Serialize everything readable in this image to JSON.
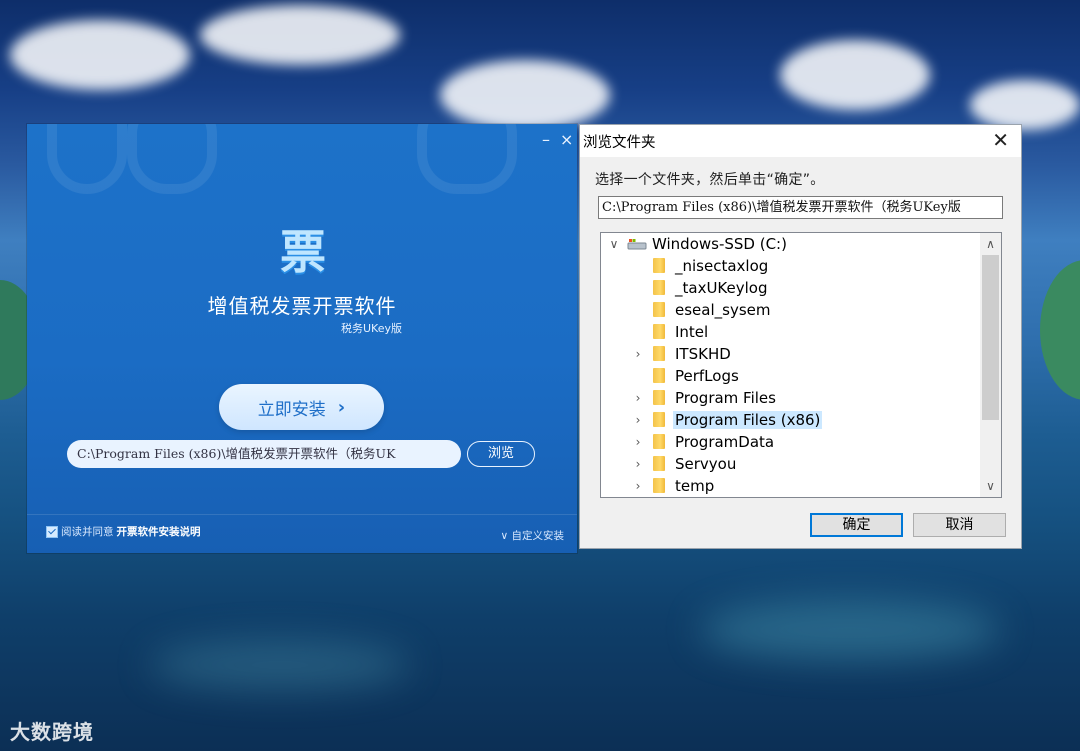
{
  "installer": {
    "minimize_glyph": "–",
    "close_glyph": "×",
    "logo_char": "票",
    "title": "增值税发票开票软件",
    "subtitle": "税务UKey版",
    "install_label": "立即安装",
    "install_chevron": "›",
    "install_path": "C:\\Program Files (x86)\\增值税发票开票软件（税务UK",
    "browse_label": "浏览",
    "agree_prefix": "阅读并同意",
    "agree_link": "开票软件安装说明",
    "agree_checked": true,
    "custom_install": "∨ 自定义安装"
  },
  "dialog": {
    "title": "浏览文件夹",
    "close_glyph": "✕",
    "instruction": "选择一个文件夹，然后单击“确定”。",
    "path_value": "C:\\Program Files (x86)\\增值税发票开票软件（税务UKey版",
    "tree": {
      "root_expander": "∨",
      "root_label": "Windows-SSD (C:)",
      "items": [
        {
          "label": "_nisectaxlog",
          "expander": ""
        },
        {
          "label": "_taxUKeylog",
          "expander": ""
        },
        {
          "label": "eseal_sysem",
          "expander": ""
        },
        {
          "label": "Intel",
          "expander": ""
        },
        {
          "label": "ITSKHD",
          "expander": "›"
        },
        {
          "label": "PerfLogs",
          "expander": ""
        },
        {
          "label": "Program Files",
          "expander": "›"
        },
        {
          "label": "Program Files (x86)",
          "expander": "›",
          "selected": true
        },
        {
          "label": "ProgramData",
          "expander": "›"
        },
        {
          "label": "Servyou",
          "expander": "›"
        },
        {
          "label": "temp",
          "expander": "›"
        }
      ]
    },
    "scroll_up": "∧",
    "scroll_down": "∨",
    "ok_label": "确定",
    "cancel_label": "取消"
  },
  "watermark": "大数跨境",
  "colors": {
    "installer_blue": "#1b6cc4",
    "selection": "#cce8ff",
    "dialog_bg": "#f0f0f0",
    "default_button_border": "#0078d7"
  }
}
